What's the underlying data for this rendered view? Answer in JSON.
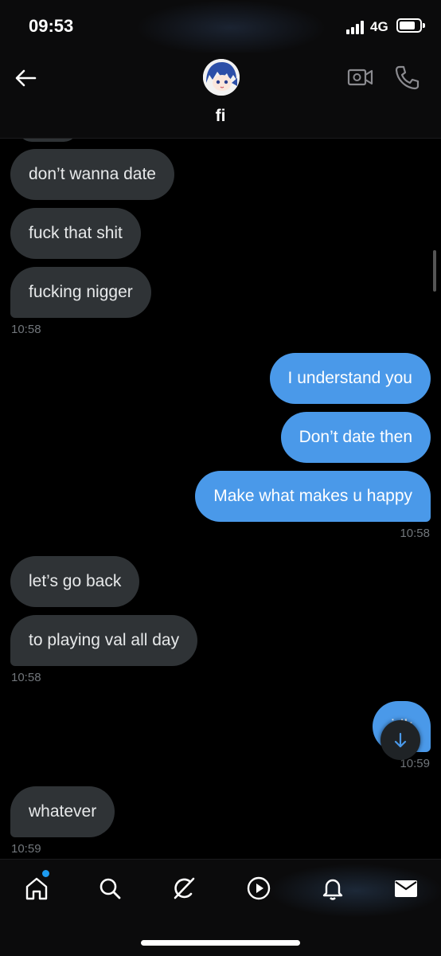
{
  "status_bar": {
    "time": "09:53",
    "network": "4G",
    "battery_level": 0.8
  },
  "header": {
    "back_icon": "arrow-left-icon",
    "contact_name": "fi",
    "video_icon": "video-call-icon",
    "call_icon": "phone-icon"
  },
  "messages": [
    {
      "side": "in",
      "text": "don’t wanna date"
    },
    {
      "side": "in",
      "text": "fuck that shit"
    },
    {
      "side": "in",
      "text": "fucking nigger"
    },
    {
      "stamp": "10:58"
    },
    {
      "side": "out",
      "text": "I understand you"
    },
    {
      "side": "out",
      "text": "Don’t date then"
    },
    {
      "side": "out",
      "text": "Make what makes u happy"
    },
    {
      "stamp": "10:58"
    },
    {
      "side": "in",
      "text": "let’s go back"
    },
    {
      "side": "in",
      "text": "to playing val all day"
    },
    {
      "stamp": "10:58"
    },
    {
      "side": "out",
      "text": "idk"
    },
    {
      "stamp": "10:59"
    },
    {
      "side": "in",
      "text": "whatever"
    },
    {
      "stamp": "10:59"
    }
  ],
  "bottom_nav": {
    "items": [
      "home-icon",
      "search-icon",
      "grok-icon",
      "video-play-icon",
      "bell-icon",
      "mail-icon"
    ],
    "home_has_notification": true
  },
  "colors": {
    "background": "#000000",
    "incoming_bubble": "#2f3336",
    "outgoing_bubble": "#4a99e9",
    "timestamp": "#71767b",
    "accent": "#1d9bf0"
  }
}
